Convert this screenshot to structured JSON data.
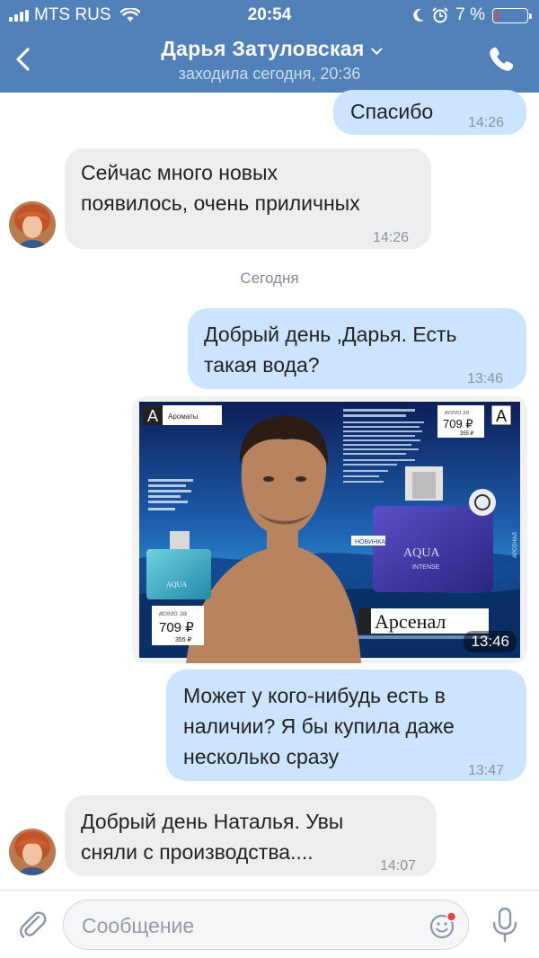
{
  "status_bar": {
    "carrier": "MTS RUS",
    "time": "20:54",
    "battery": "7 %",
    "battery_level": 0.07
  },
  "header": {
    "name": "Дарья Затуловская",
    "last_seen": "заходила сегодня, 20:36"
  },
  "messages": [
    {
      "id": "m1",
      "direction": "out",
      "lines": [
        "Спасибо"
      ],
      "time": "14:26"
    },
    {
      "id": "m2",
      "direction": "in",
      "lines": [
        "Сейчас много новых",
        "появилось, очень приличных"
      ],
      "time": "14:26"
    },
    {
      "id": "m3",
      "direction": "out",
      "lines": [
        "Добрый день ,Дарья. Есть",
        "такая вода?"
      ],
      "time": "13:46"
    },
    {
      "id": "m4",
      "direction": "out",
      "type": "photo",
      "time": "13:46"
    },
    {
      "id": "m5",
      "direction": "out",
      "lines": [
        "Может у кого-нибудь есть в",
        "наличии? Я бы купила даже",
        "несколько сразу"
      ],
      "time": "13:47"
    },
    {
      "id": "m6",
      "direction": "in",
      "lines": [
        "Добрый день Наталья. Увы",
        "сняли с производства...."
      ],
      "time": "14:07"
    }
  ],
  "day_separator": "Сегодня",
  "photo": {
    "catalog_section": "Ароматы",
    "section_letter": "A",
    "price_prefix": "всего за",
    "price_main": "709 ₽",
    "price_alt": "355 ₽",
    "brand": "Арсенал",
    "product": "AQUA",
    "product_sub": "INTENSE",
    "badge": "НОВИНКА",
    "side_label": "АРСЕНАЛ"
  },
  "composer": {
    "placeholder": "Сообщение"
  },
  "colors": {
    "header_bg": "#5181b8",
    "outgoing_bubble": "#cce4ff",
    "incoming_bubble": "#edeef0",
    "notification_dot": "#e64646"
  }
}
